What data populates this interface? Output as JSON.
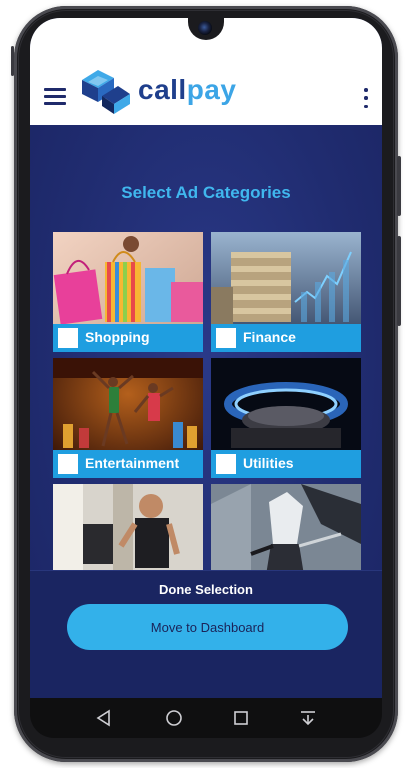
{
  "app": {
    "logo_call": "call",
    "logo_pay": "pay"
  },
  "header": {
    "menu_icon": "hamburger-menu-icon",
    "more_icon": "more-vertical-icon"
  },
  "main": {
    "title": "Select Ad Categories",
    "categories": [
      {
        "label": "Shopping",
        "checked": false
      },
      {
        "label": "Finance",
        "checked": false
      },
      {
        "label": "Entertainment",
        "checked": false
      },
      {
        "label": "Utilities",
        "checked": false
      }
    ]
  },
  "footer": {
    "done_label": "Done Selection",
    "dashboard_button": "Move to Dashboard"
  },
  "colors": {
    "accent": "#33b1ea",
    "background": "#1f2a6b",
    "label_bar": "#1f9ee0",
    "brand_dark": "#1f3f8c"
  },
  "navbar": {
    "icons": [
      "back-icon",
      "home-icon",
      "recent-apps-icon",
      "notification-pull-icon"
    ]
  }
}
